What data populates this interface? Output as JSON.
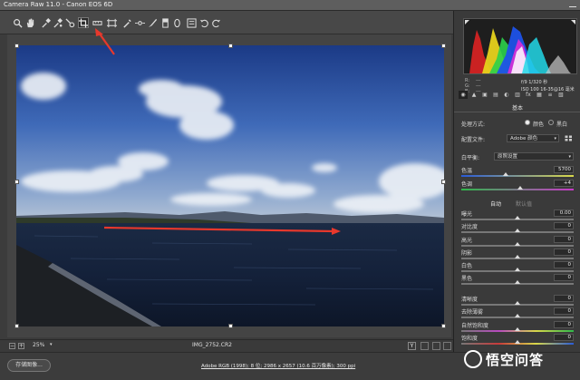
{
  "window": {
    "title": "Camera Raw 11.0 - Canon EOS 6D"
  },
  "toolbar": {
    "tools": [
      {
        "name": "zoom-tool-icon",
        "glyph": "🔍"
      },
      {
        "name": "hand-tool-icon",
        "glyph": "✋"
      },
      {
        "name": "white-balance-tool-icon",
        "glyph": "eyedropper"
      },
      {
        "name": "color-sampler-tool-icon",
        "glyph": "eyedropper"
      },
      {
        "name": "targeted-adjustment-tool-icon",
        "glyph": "target"
      },
      {
        "name": "crop-tool-icon",
        "glyph": "crop"
      },
      {
        "name": "straighten-tool-icon",
        "glyph": "ruler"
      },
      {
        "name": "transform-tool-icon",
        "glyph": "transform"
      },
      {
        "name": "spot-removal-tool-icon",
        "glyph": "brush"
      },
      {
        "name": "red-eye-tool-icon",
        "glyph": "eye"
      },
      {
        "name": "adjustment-brush-icon",
        "glyph": "brush"
      },
      {
        "name": "graduated-filter-icon",
        "glyph": "rect"
      },
      {
        "name": "radial-filter-icon",
        "glyph": "ellipse"
      },
      {
        "name": "open-preferences-icon",
        "glyph": "prefs"
      },
      {
        "name": "rotate-ccw-icon",
        "glyph": "rotl"
      },
      {
        "name": "rotate-cw-icon",
        "glyph": "rotr"
      }
    ]
  },
  "camera_info": {
    "r": "R:",
    "g": "G:",
    "b": "B:",
    "r_val": "---",
    "g_val": "---",
    "b_val": "---",
    "aperture_shutter": "f/9   1/320 秒",
    "iso_lens": "ISO 100   16-35@16 毫米"
  },
  "panel": {
    "tabs": [
      "◉",
      "▲",
      "▣",
      "▤",
      "◐",
      "▥",
      "fx",
      "▦",
      "≡",
      "▧"
    ],
    "title": "基本",
    "treatment_label": "处理方式:",
    "treatment_color": "颜色",
    "treatment_bw": "黑白",
    "profile_label": "配置文件:",
    "profile_value": "Adobe 颜色",
    "wb_label": "白平衡:",
    "wb_value": "原照设置",
    "temp_label": "色温",
    "temp_value": "5700",
    "tint_label": "色调",
    "tint_value": "+4",
    "auto_label": "自动",
    "default_label": "默认值",
    "sliders": [
      {
        "label": "曝光",
        "value": "0.00"
      },
      {
        "label": "对比度",
        "value": "0"
      },
      {
        "label": "高光",
        "value": "0"
      },
      {
        "label": "阴影",
        "value": "0"
      },
      {
        "label": "白色",
        "value": "0"
      },
      {
        "label": "黑色",
        "value": "0"
      },
      {
        "label": "清晰度",
        "value": "0"
      },
      {
        "label": "去除薄雾",
        "value": "0"
      },
      {
        "label": "自然饱和度",
        "value": "0"
      },
      {
        "label": "饱和度",
        "value": "0"
      }
    ]
  },
  "statusbar": {
    "zoom_value": "25%",
    "filename": "IMG_2752.CR2"
  },
  "bottombar": {
    "save_label": "存储图像...",
    "workflow": "Adobe RGB (1998); 8 位; 2986 x 2657 (10.6 百万像素); 300 ppi",
    "watermark": "悟空问答"
  },
  "colors": {
    "annotation_arrow": "#e8382c"
  }
}
